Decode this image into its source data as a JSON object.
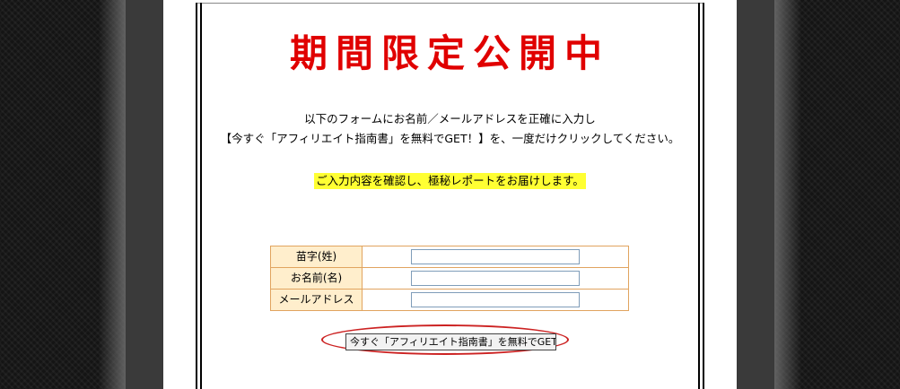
{
  "page": {
    "title": "期間限定公開中",
    "lead_line1": "以下のフォームにお名前／メールアドレスを正確に入力し",
    "lead_line2": "【今すぐ「アフィリエイト指南書」を無料でGET！】を、一度だけクリックしてください。",
    "notice": "ご入力内容を確認し、極秘レポートをお届けします。"
  },
  "form": {
    "fields": [
      {
        "label": "苗字(姓)",
        "value": ""
      },
      {
        "label": "お名前(名)",
        "value": ""
      },
      {
        "label": "メールアドレス",
        "value": ""
      }
    ],
    "submit_label": "今すぐ「アフィリエイト指南書」を無料でGET！"
  },
  "colors": {
    "title": "#e00000",
    "notice_highlight": "#ffff33",
    "form_label_bg": "#ffeecc",
    "form_border": "#e1a45f",
    "ellipse": "#cc2222",
    "page_bg": "#ffffff",
    "side_bg": "#141414",
    "side_band": "#3a3a3a"
  }
}
